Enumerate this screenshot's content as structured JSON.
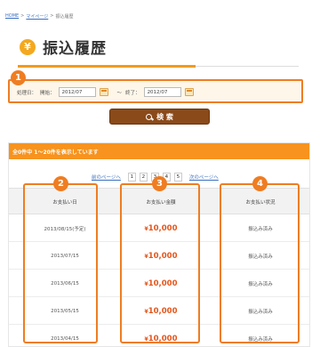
{
  "breadcrumb": {
    "home": "HOME",
    "sep": ">",
    "mypage": "マイページ",
    "current": "振込履歴"
  },
  "title": "振込履歴",
  "search": {
    "label_prefix": "処理日：",
    "start_label": "開始：",
    "start_value": "2012/07",
    "range_sep": "～",
    "end_label": "終了：",
    "end_value": "2012/07",
    "button_label": "検 索"
  },
  "results": {
    "summary": "全0件中 1～20件を表示しています",
    "prev_page": "前のページへ",
    "next_page": "次のページへ",
    "pages": [
      "1",
      "2",
      "3",
      "4",
      "5"
    ]
  },
  "table": {
    "columns": [
      "お支払い日",
      "お支払い金額",
      "お支払い状況"
    ],
    "rows": [
      {
        "date": "2013/08/15(予定)",
        "yen": "¥",
        "amount": "10,000",
        "status": "振込み済み"
      },
      {
        "date": "2013/07/15",
        "yen": "¥",
        "amount": "10,000",
        "status": "振込み済み"
      },
      {
        "date": "2013/06/15",
        "yen": "¥",
        "amount": "10,000",
        "status": "振込み済み"
      },
      {
        "date": "2013/05/15",
        "yen": "¥",
        "amount": "10,000",
        "status": "振込み済み"
      },
      {
        "date": "2013/04/15",
        "yen": "¥",
        "amount": "10,000",
        "status": "振込み済み"
      }
    ]
  },
  "markers": [
    "1",
    "2",
    "3",
    "4"
  ],
  "icons": {
    "title": "yen-icon",
    "search": "search-icon",
    "calendar": "calendar-icon"
  },
  "colors": {
    "accent": "#ef7d22",
    "header": "#f7931e",
    "button": "#8a4a1a",
    "amount": "#e5551a"
  }
}
